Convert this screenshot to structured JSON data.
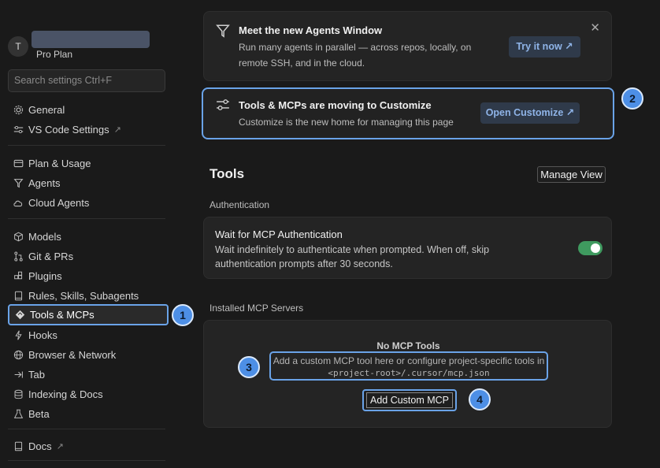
{
  "profile": {
    "initial": "T",
    "plan": "Pro Plan"
  },
  "search": {
    "placeholder": "Search settings Ctrl+F"
  },
  "sidebar": {
    "items": [
      {
        "label": "General",
        "icon": "gear-icon"
      },
      {
        "label": "VS Code Settings",
        "icon": "sliders-icon",
        "external": "↗"
      },
      {
        "label": "Plan & Usage",
        "icon": "card-icon"
      },
      {
        "label": "Agents",
        "icon": "agent-icon"
      },
      {
        "label": "Cloud Agents",
        "icon": "cloud-icon"
      },
      {
        "label": "Models",
        "icon": "cube-icon"
      },
      {
        "label": "Git & PRs",
        "icon": "git-icon"
      },
      {
        "label": "Plugins",
        "icon": "plugins-icon"
      },
      {
        "label": "Rules, Skills, Subagents",
        "icon": "book-icon"
      },
      {
        "label": "Tools & MCPs",
        "icon": "tools-icon"
      },
      {
        "label": "Hooks",
        "icon": "hooks-icon"
      },
      {
        "label": "Browser & Network",
        "icon": "globe-icon"
      },
      {
        "label": "Tab",
        "icon": "tab-icon"
      },
      {
        "label": "Indexing & Docs",
        "icon": "database-icon"
      },
      {
        "label": "Beta",
        "icon": "flask-icon"
      },
      {
        "label": "Docs",
        "icon": "docs-icon",
        "external": "↗"
      }
    ]
  },
  "banner_agents": {
    "title": "Meet the new Agents Window",
    "text": "Run many agents in parallel — across repos, locally, on remote SSH, and in the cloud.",
    "button": "Try it now ↗",
    "close": "✕"
  },
  "banner_customize": {
    "title": "Tools & MCPs are moving to Customize",
    "text": "Customize is the new home for managing this page",
    "button": "Open Customize ↗"
  },
  "tools": {
    "title": "Tools",
    "manage_view": "Manage View",
    "auth_section": "Authentication",
    "auth_title": "Wait for MCP Authentication",
    "auth_desc": "Wait indefinitely to authenticate when prompted. When off, skip authentication prompts after 30 seconds.",
    "auth_enabled": true,
    "installed_section": "Installed MCP Servers",
    "no_mcp_title": "No MCP Tools",
    "no_mcp_desc": "Add a custom MCP tool here or configure project-specific tools in",
    "no_mcp_path": "<project-root>/.cursor/mcp.json",
    "add_button": "Add Custom MCP"
  },
  "badges": [
    "1",
    "2",
    "3",
    "4"
  ],
  "colors": {
    "accent": "#6aa3e8",
    "toggle_on": "#3f9a5f",
    "badge": "#4d8fe6"
  }
}
